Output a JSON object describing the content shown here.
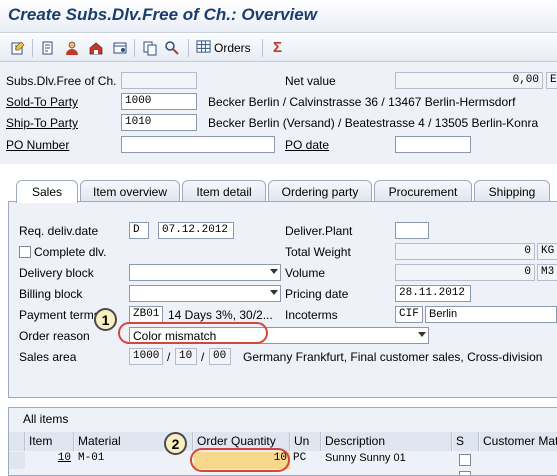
{
  "title": "Create Subs.Dlv.Free of Ch.: Overview",
  "toolbar": {
    "orders_label": "Orders"
  },
  "header": {
    "doc_label": "Subs.Dlv.Free of Ch.",
    "doc_value": "",
    "net_value_label": "Net value",
    "net_value": "0,00",
    "net_currency": "E",
    "sold_to_label": "Sold-To Party",
    "sold_to_value": "1000",
    "sold_to_desc": "Becker Berlin / Calvinstrasse 36 / 13467 Berlin-Hermsdorf",
    "ship_to_label": "Ship-To Party",
    "ship_to_value": "1010",
    "ship_to_desc": "Becker Berlin (Versand) / Beatestrasse 4 / 13505 Berlin-Konra",
    "po_number_label": "PO Number",
    "po_number_value": "",
    "po_date_label": "PO date",
    "po_date_value": ""
  },
  "tabs": [
    "Sales",
    "Item overview",
    "Item detail",
    "Ordering party",
    "Procurement",
    "Shipping"
  ],
  "sales": {
    "req_deliv_label": "Req. deliv.date",
    "req_deliv_type": "D",
    "req_deliv_value": "07.12.2012",
    "deliver_plant_label": "Deliver.Plant",
    "deliver_plant_value": "",
    "complete_dlv_label": "Complete dlv.",
    "total_weight_label": "Total Weight",
    "total_weight_value": "0",
    "total_weight_unit": "KG",
    "delivery_block_label": "Delivery block",
    "delivery_block_value": "",
    "volume_label": "Volume",
    "volume_value": "0",
    "volume_unit": "M3",
    "billing_block_label": "Billing block",
    "billing_block_value": "",
    "pricing_date_label": "Pricing date",
    "pricing_date_value": "28.11.2012",
    "payment_terms_label": "Payment terms",
    "payment_terms_value": "ZB01",
    "payment_terms_desc": "14 Days 3%, 30/2...",
    "incoterms_label": "Incoterms",
    "incoterms_value": "CIF",
    "incoterms_desc": "Berlin",
    "order_reason_label": "Order reason",
    "order_reason_value": "Color mismatch",
    "sales_area_label": "Sales area",
    "sales_org": "1000",
    "dist_channel": "10",
    "division": "00",
    "sales_area_desc": "Germany Frankfurt, Final customer sales, Cross-division"
  },
  "items": {
    "section_label": "All items",
    "columns": [
      "Item",
      "Material",
      "Order Quantity",
      "Un",
      "Description",
      "S",
      "Customer Mat"
    ],
    "rows": [
      {
        "item": "10",
        "material": "M-01",
        "quantity": "10",
        "unit": "PC",
        "description": "Sunny Sunny 01"
      }
    ]
  },
  "callouts": [
    "1",
    "2"
  ]
}
